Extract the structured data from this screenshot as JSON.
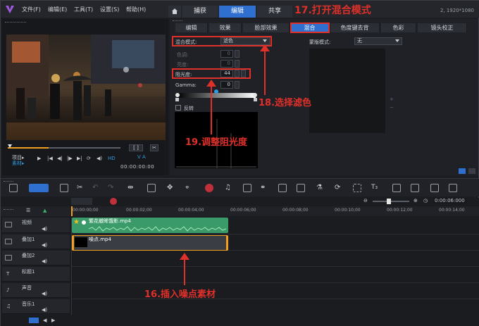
{
  "titlebar": {
    "menus": [
      "文件(F)",
      "编辑(E)",
      "工具(T)",
      "设置(S)",
      "帮助(H)"
    ],
    "tabs": [
      "捕获",
      "编辑",
      "共享"
    ],
    "active_tab": "编辑",
    "resolution": "2, 1920*1080"
  },
  "annotations": {
    "step17": "17.打开混合模式",
    "step18": "18.选择滤色",
    "step19": "19.调整阻光度",
    "step16": "16.插入噪点素材"
  },
  "preview": {
    "project_label": "项目▸",
    "clip_label": "素材▸",
    "timecode": "00:00:00:00",
    "hd_label": "HD"
  },
  "options": {
    "tabs": [
      "编辑",
      "效果",
      "脸部效果",
      "混合",
      "色度键去背",
      "色彩",
      "镜头校正"
    ],
    "active_tab": "混合",
    "blend_mode_label": "混合模式:",
    "blend_mode_value": "滤色",
    "hue_label": "色调:",
    "hue_value": "0",
    "brightness_label": "亮度:",
    "brightness_value": "0",
    "opacity_label": "阻光度:",
    "opacity_value": "44",
    "gamma_label": "Gamma:",
    "gamma_value": "0",
    "invert_label": "反转",
    "mask_label": "蒙版模式:",
    "mask_value": "无"
  },
  "toolbar": {
    "zoom_time": "0:00:06:000"
  },
  "timeline": {
    "ruler": [
      "00:00:00;00",
      "00:00:02;00",
      "00:00:04;00",
      "00:00:06;00",
      "00:00:08;00",
      "00:00:10;00",
      "00:00:12;00",
      "00:00:14;00"
    ],
    "tracks": [
      "视频",
      "叠加1",
      "叠加2",
      "标题1",
      "声音",
      "音乐1"
    ],
    "clips": [
      {
        "track": "视频",
        "name": "繁花撤眸饿影.mp4"
      },
      {
        "track": "叠加1",
        "name": "噪点.mp4"
      }
    ]
  },
  "colors": {
    "accent": "#2f6fcf",
    "annotation": "#e0302a",
    "video_clip": "#3a9a6a",
    "overlay_clip": "#3a3d44",
    "selection": "#f0a020"
  }
}
